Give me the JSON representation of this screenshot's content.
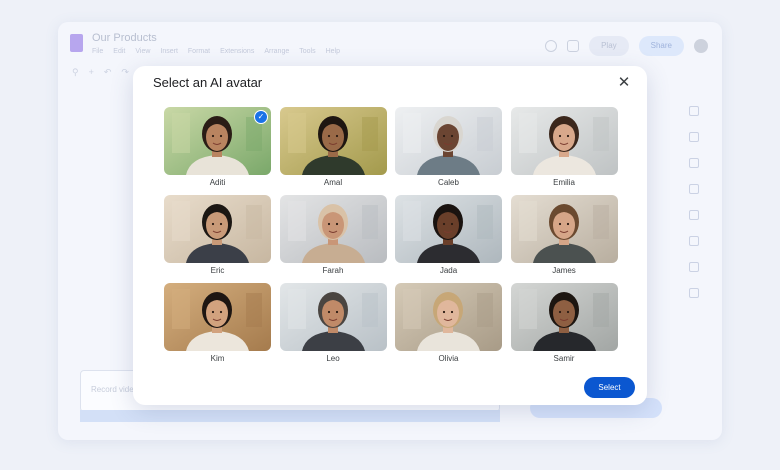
{
  "background": {
    "doc_title": "Our Products",
    "menus": [
      "File",
      "Edit",
      "View",
      "Insert",
      "Format",
      "Extensions",
      "Arrange",
      "Tools",
      "Help"
    ],
    "play_label": "Play",
    "share_label": "Share",
    "input_placeholder": "Record video"
  },
  "dialog": {
    "title": "Select an AI avatar",
    "select_label": "Select",
    "avatars": [
      {
        "name": "Aditi",
        "selected": true,
        "bg": "#7aa86a",
        "bg2": "#c9d8a6",
        "skin": "#b98460",
        "hair": "#2a1d16",
        "shirt": "#e8e3d8"
      },
      {
        "name": "Amal",
        "selected": false,
        "bg": "#a39a4c",
        "bg2": "#d8c98e",
        "skin": "#9a6a48",
        "hair": "#1e1611",
        "shirt": "#2f3a2c"
      },
      {
        "name": "Caleb",
        "selected": false,
        "bg": "#c8cdd2",
        "bg2": "#eef0f2",
        "skin": "#6b4532",
        "hair": "#d9d6d0",
        "shirt": "#6d7c86"
      },
      {
        "name": "Emilia",
        "selected": false,
        "bg": "#bfc3c4",
        "bg2": "#e7e9e9",
        "skin": "#d8a88b",
        "hair": "#3b271c",
        "shirt": "#ece7df"
      },
      {
        "name": "Eric",
        "selected": false,
        "bg": "#c7b7a1",
        "bg2": "#e8dccb",
        "skin": "#c99a78",
        "hair": "#1c1713",
        "shirt": "#3b3f48"
      },
      {
        "name": "Farah",
        "selected": false,
        "bg": "#b9bcc0",
        "bg2": "#e3e4e5",
        "skin": "#c99677",
        "hair": "#d9c2a7",
        "shirt": "#c7ad92"
      },
      {
        "name": "Jada",
        "selected": false,
        "bg": "#aeb7bd",
        "bg2": "#dde2e5",
        "skin": "#6a3f2a",
        "hair": "#1a1310",
        "shirt": "#2c2c30"
      },
      {
        "name": "James",
        "selected": false,
        "bg": "#b8ae9f",
        "bg2": "#e4ddd2",
        "skin": "#d6a688",
        "hair": "#6b4a30",
        "shirt": "#4b5150"
      },
      {
        "name": "Kim",
        "selected": false,
        "bg": "#a57b4d",
        "bg2": "#d4ae7e",
        "skin": "#d2a27e",
        "hair": "#1e1612",
        "shirt": "#ece6dc"
      },
      {
        "name": "Leo",
        "selected": false,
        "bg": "#b9c1c7",
        "bg2": "#e2e6e8",
        "skin": "#c08a68",
        "hair": "#4a4541",
        "shirt": "#3c3f45"
      },
      {
        "name": "Olivia",
        "selected": false,
        "bg": "#a89b87",
        "bg2": "#d5cab7",
        "skin": "#e0b79c",
        "hair": "#c7a777",
        "shirt": "#e9e4db"
      },
      {
        "name": "Samir",
        "selected": false,
        "bg": "#a2a6a4",
        "bg2": "#d4d6d4",
        "skin": "#8e5f42",
        "hair": "#1d1611",
        "shirt": "#26282c"
      }
    ]
  }
}
